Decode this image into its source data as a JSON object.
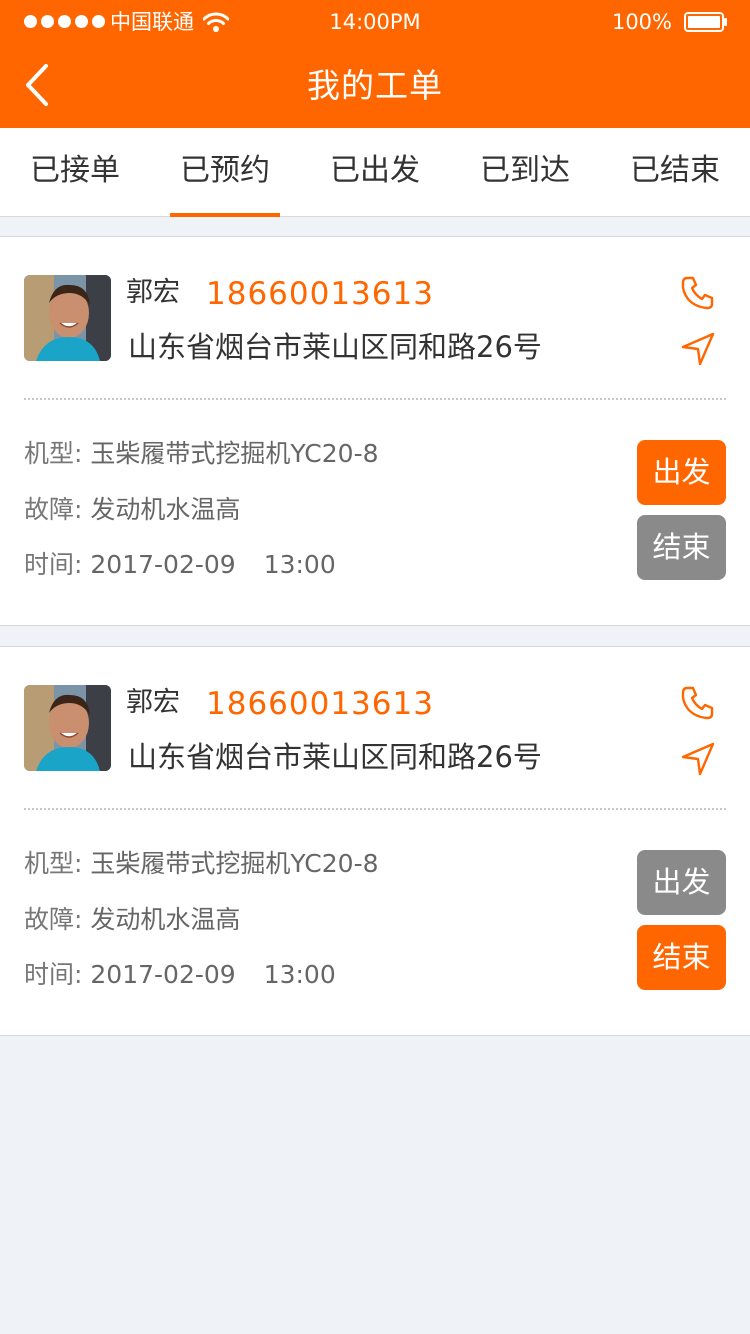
{
  "status_bar": {
    "carrier": "中国联通",
    "time": "14:00PM",
    "battery": "100%"
  },
  "header": {
    "title": "我的工单"
  },
  "tabs": [
    {
      "label": "已接单",
      "active": false
    },
    {
      "label": "已预约",
      "active": true
    },
    {
      "label": "已出发",
      "active": false
    },
    {
      "label": "已到达",
      "active": false
    },
    {
      "label": "已结束",
      "active": false
    }
  ],
  "orders": [
    {
      "name": "郭宏",
      "phone": "18660013613",
      "address": "山东省烟台市莱山区同和路26号",
      "model_label": "机型:",
      "model": "玉柴履带式挖掘机YC20-8",
      "fault_label": "故障:",
      "fault": "发动机水温高",
      "time_label": "时间:",
      "date": "2017-02-09",
      "time": "13:00",
      "depart_label": "出发",
      "finish_label": "结束",
      "depart_enabled": true,
      "finish_enabled": false
    },
    {
      "name": "郭宏",
      "phone": "18660013613",
      "address": "山东省烟台市莱山区同和路26号",
      "model_label": "机型:",
      "model": "玉柴履带式挖掘机YC20-8",
      "fault_label": "故障:",
      "fault": "发动机水温高",
      "time_label": "时间:",
      "date": "2017-02-09",
      "time": "13:00",
      "depart_label": "出发",
      "finish_label": "结束",
      "depart_enabled": false,
      "finish_enabled": true
    }
  ],
  "colors": {
    "accent": "#ff6600",
    "disabled": "#8a8a8a",
    "background": "#eff2f7"
  },
  "icons": {
    "back": "chevron-left-icon",
    "call": "phone-icon",
    "navigate": "navigation-arrow-icon",
    "wifi": "wifi-icon",
    "battery": "battery-icon"
  }
}
